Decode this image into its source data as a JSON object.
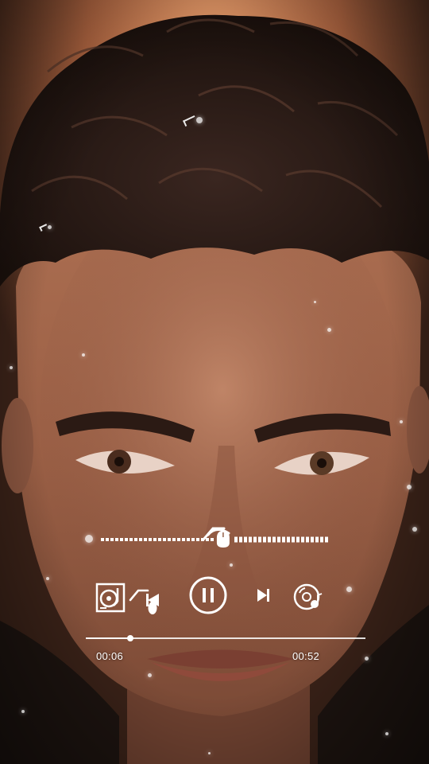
{
  "player": {
    "elapsed": "00:06",
    "total": "00:52",
    "progress_fraction": 0.16,
    "eq_position_fraction": 0.54
  },
  "icons": {
    "left_control": "vinyl-turntable-icon",
    "previous": "skip-previous-icon",
    "play_pause": "pause-icon",
    "next": "skip-next-icon",
    "right_control": "music-disc-icon"
  },
  "colors": {
    "controls": "#ffffff",
    "background_dark": "#2a1a12",
    "background_warm": "#c9845a"
  }
}
